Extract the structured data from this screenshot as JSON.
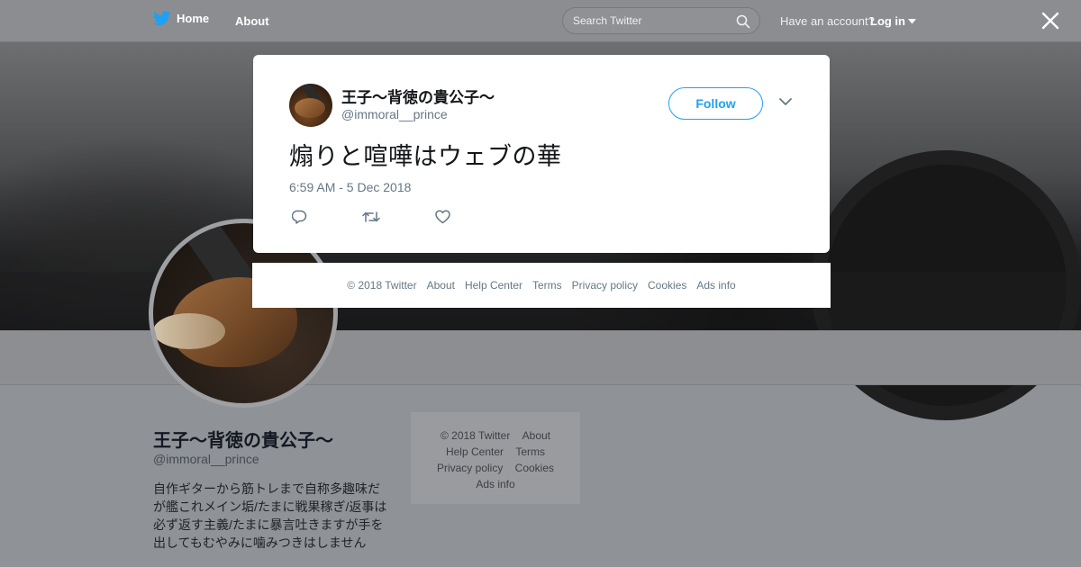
{
  "nav": {
    "home_label": "Home",
    "about_label": "About",
    "search_placeholder": "Search Twitter",
    "have_account_text": "Have an account?",
    "login_label": "Log in"
  },
  "tweet": {
    "name": "王子～背徳の貴公子～",
    "handle": "@immoral__prince",
    "follow_label": "Follow",
    "text": "煽りと喧嘩はウェブの華",
    "timestamp": "6:59 AM - 5 Dec 2018"
  },
  "modal_footer": {
    "copyright": "© 2018 Twitter",
    "about": "About",
    "help_center": "Help Center",
    "terms": "Terms",
    "privacy": "Privacy policy",
    "cookies": "Cookies",
    "ads_info": "Ads info"
  },
  "profile": {
    "name": "王子～背徳の貴公子～",
    "handle": "@immoral__prince",
    "bio": "自作ギターから筋トレまで自称多趣味だ\nが艦これメイン垢/たまに戦果稼ぎ/返事は\n必ず返す主義/たまに暴言吐きますが手を\n出してもむやみに噛みつきはしません"
  },
  "side_footer": {
    "copyright": "© 2018 Twitter",
    "about": "About",
    "help_center": "Help Center",
    "terms": "Terms",
    "privacy": "Privacy policy",
    "cookies": "Cookies",
    "ads_info": "Ads info"
  },
  "colors": {
    "twitter_blue": "#1da1f2",
    "overlay_gray": "#8f9296",
    "text_dark": "#14171a",
    "text_muted": "#657786"
  },
  "icons": {
    "nav_home": "twitter-bird-icon",
    "search": "search-icon",
    "login": "caret-down-icon",
    "close": "close-icon",
    "more": "chevron-down-icon",
    "reply": "reply-icon",
    "retweet": "retweet-icon",
    "like": "heart-icon"
  }
}
